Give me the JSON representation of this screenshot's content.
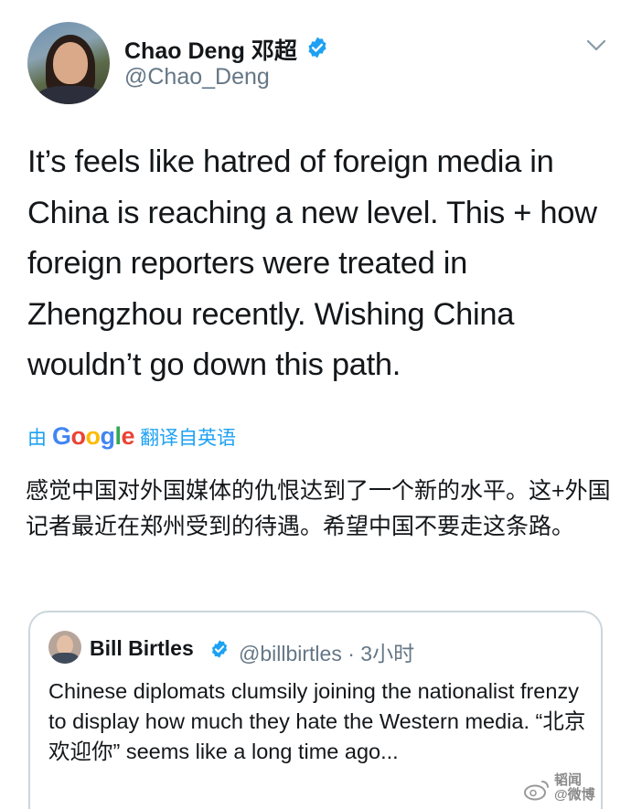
{
  "tweet": {
    "author": {
      "display_name": "Chao Deng 邓超",
      "handle": "@Chao_Deng",
      "verified": true
    },
    "text": "It’s feels like hatred of foreign media in China is reaching a new level. This + how foreign reporters were treated in Zhengzhou recently. Wishing China wouldn’t go down this path.",
    "translated_prefix": "由",
    "translated_brand": "Google",
    "translated_suffix": "翻译自英语",
    "translation": "感觉中国对外国媒体的仇恨达到了一个新的水平。这+外国记者最近在郑州受到的待遇。希望中国不要走这条路。"
  },
  "quoted_tweet": {
    "display_name": "Bill Birtles",
    "handle": "@billbirtles",
    "separator": "·",
    "time": "3小时",
    "verified": true,
    "text": "Chinese diplomats clumsily joining the nationalist frenzy to display how much they hate the Western media. “北京欢迎你” seems like a long time ago..."
  },
  "watermark": {
    "line1": "韬闻",
    "line2": "@微博"
  },
  "colors": {
    "accent": "#1da1f2",
    "verified": "#1da1f2",
    "secondary_text": "#657786",
    "border": "#ccd6dd"
  }
}
